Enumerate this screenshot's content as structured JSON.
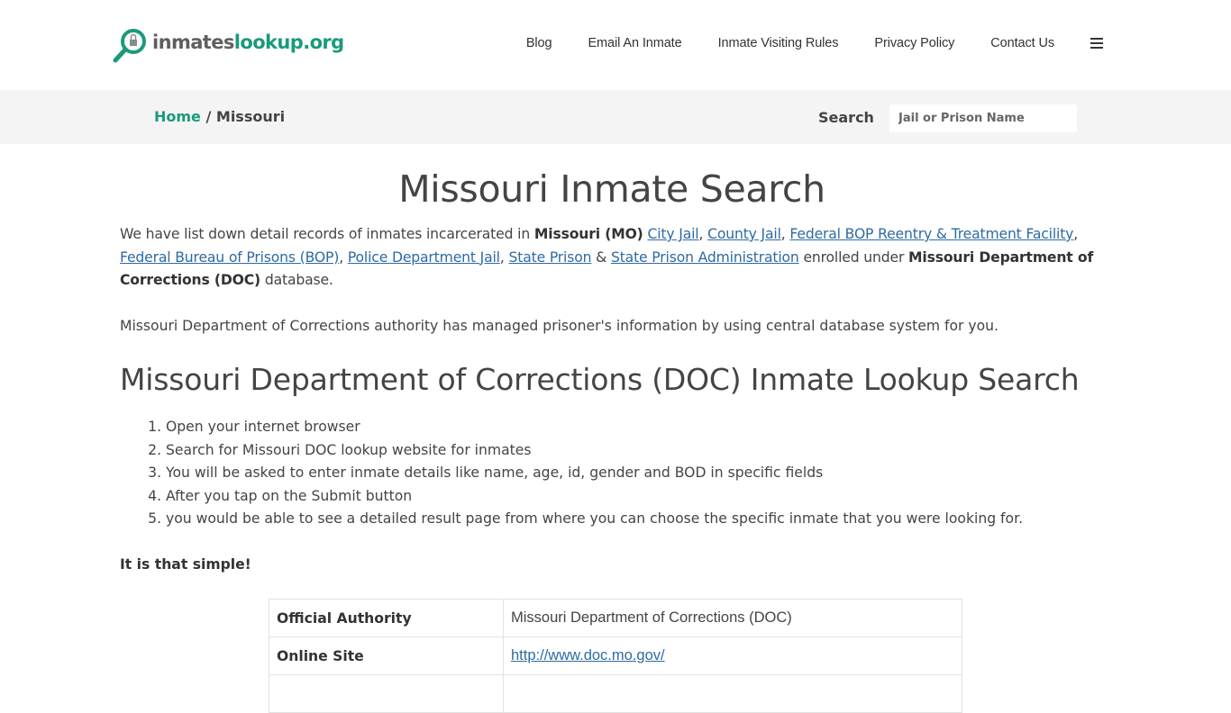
{
  "header": {
    "logo": {
      "part1": "inmates",
      "part2": "lookup.org",
      "icon": "magnifier-lock-icon"
    },
    "nav": [
      "Blog",
      "Email An Inmate",
      "Inmate Visiting Rules",
      "Privacy Policy",
      "Contact Us"
    ],
    "menu_icon": "hamburger-icon"
  },
  "breadcrumb": {
    "home": "Home",
    "separator": " / ",
    "current": "Missouri"
  },
  "search": {
    "label": "Search",
    "placeholder": "Jail or Prison Name"
  },
  "main": {
    "title": "Missouri Inmate Search",
    "intro": {
      "t1": "We have list down detail records of inmates incarcerated in ",
      "b1": "Missouri (MO)",
      "links": [
        "City Jail",
        "County Jail",
        "Federal BOP Reentry & Treatment Facility",
        "Federal Bureau of Prisons (BOP)",
        "Police Department Jail",
        "State Prison",
        "State Prison Administration"
      ],
      "amp": " & ",
      "t2": " enrolled under ",
      "b2": "Missouri Department of Corrections (DOC)",
      "t3": " database."
    },
    "second_paragraph": "Missouri Department of Corrections authority has managed prisoner's information by using central database system for you.",
    "subtitle": "Missouri Department of Corrections (DOC) Inmate Lookup Search",
    "steps": [
      "Open your internet browser",
      "Search for Missouri DOC lookup website for inmates",
      "You will be asked to enter inmate details like name, age, id, gender and BOD in specific fields",
      "After you tap on the Submit button",
      "you would be able to see a detailed result page from where you can choose the specific inmate that you were looking for."
    ],
    "simple": "It is that simple!",
    "table": [
      {
        "key": "Official Authority",
        "value": "Missouri Department of Corrections (DOC)"
      },
      {
        "key": "Online Site",
        "value": "http://www.doc.mo.gov/"
      },
      {
        "key": "",
        "value": ""
      }
    ]
  }
}
